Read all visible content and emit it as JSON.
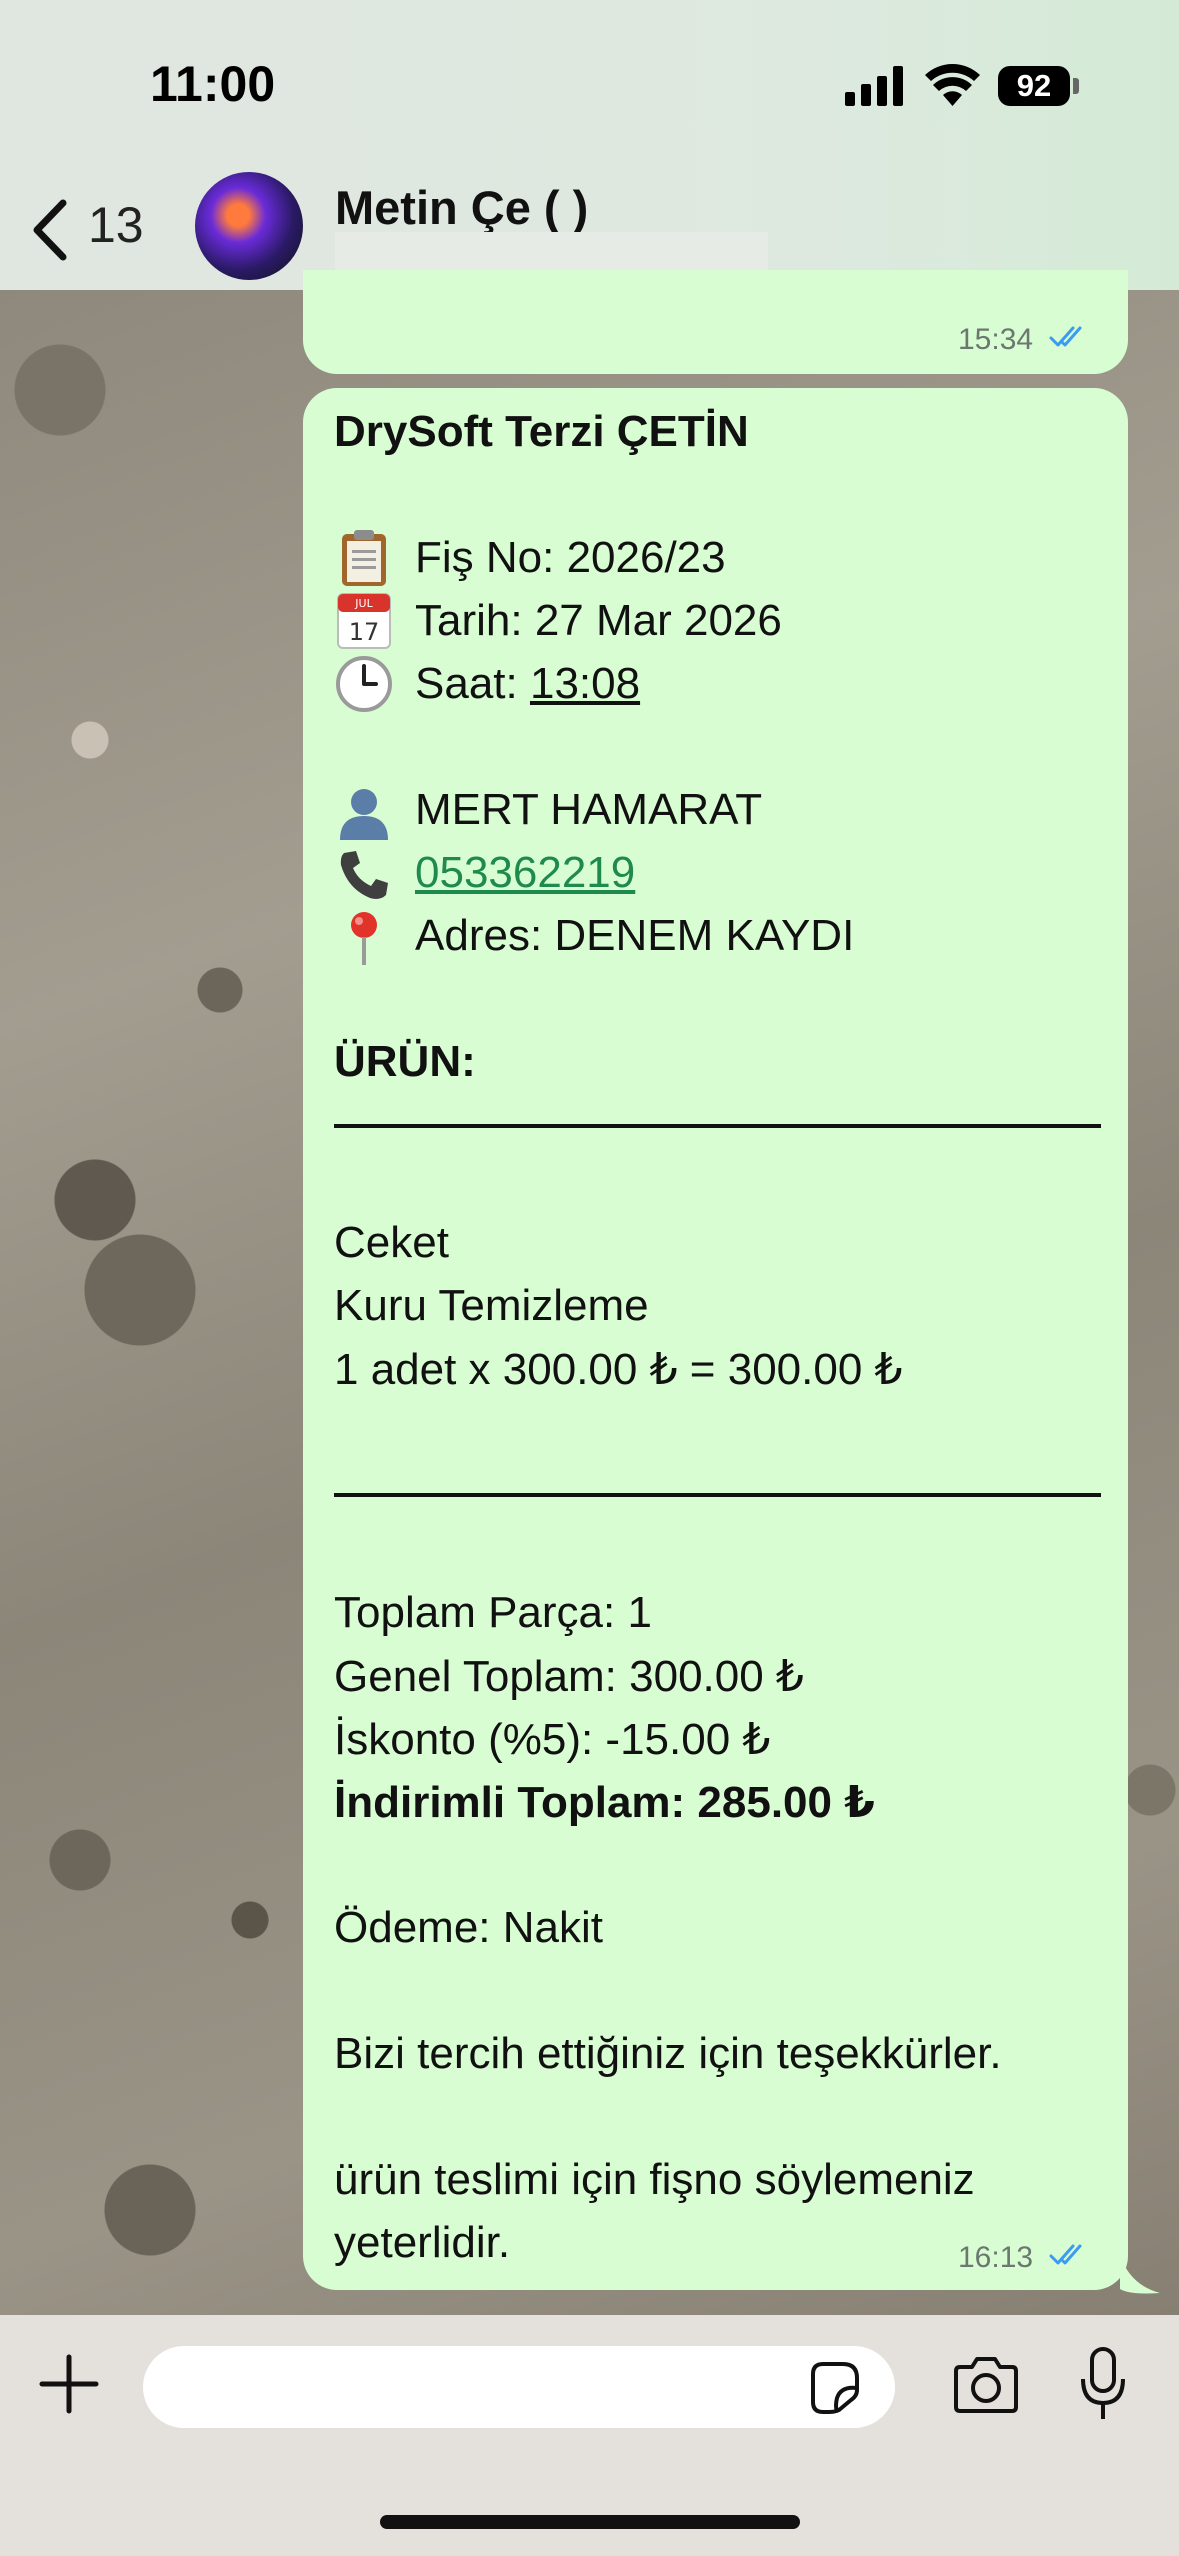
{
  "status_bar": {
    "time": "11:00",
    "battery": "92"
  },
  "header": {
    "back_count": "13",
    "contact_name": "Metin Çe   (     )"
  },
  "prev_message": {
    "time": "15:34"
  },
  "receipt": {
    "title": "DrySoft Terzi ÇETİN",
    "receipt_no": "Fiş No: 2026/23",
    "date": "Tarih: 27 Mar 2026",
    "time_prefix": "Saat: ",
    "time_value": "13:08",
    "customer": "MERT HAMARAT",
    "phone": "053362219",
    "address": "Adres: DENEM KAYDI",
    "product_heading": "ÜRÜN:",
    "item_name": "Ceket",
    "item_service": "Kuru Temizleme",
    "item_line": "1 adet x 300.00 ₺ = 300.00 ₺",
    "total_pieces": "Toplam Parça: 1",
    "grand_total": "Genel Toplam: 300.00 ₺",
    "discount": "İskonto (%5): -15.00 ₺",
    "discounted_total": "İndirimli Toplam: 285.00 ₺",
    "payment": "Ödeme: Nakit",
    "thanks": "Bizi tercih ettiğiniz için teşekkürler.",
    "note_line1": "ürün teslimi için fişno söylemeniz",
    "note_line2": "yeterlidir.",
    "sent_time": "16:13"
  },
  "icons": {
    "clipboard": "clipboard-icon",
    "calendar": "calendar-icon",
    "clock": "clock-icon",
    "person": "person-icon",
    "phone": "phone-icon",
    "pin": "pin-icon"
  },
  "colors": {
    "bubble": "#d9fdd3",
    "read_ticks": "#3a9bf0",
    "link": "#1e8a4e"
  }
}
